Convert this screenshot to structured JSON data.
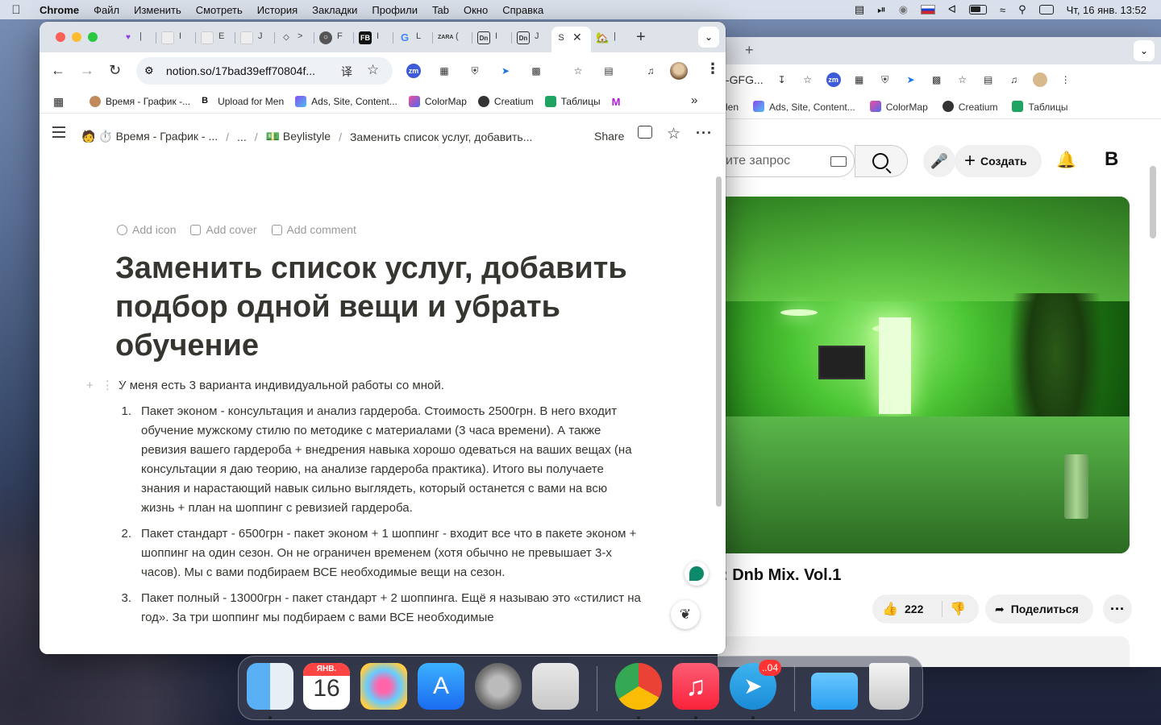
{
  "menubar": {
    "app": "Chrome",
    "items": [
      "Файл",
      "Изменить",
      "Смотреть",
      "История",
      "Закладки",
      "Профили",
      "Tab",
      "Окно",
      "Справка"
    ],
    "datetime": "Чт, 16 янв.  13:52"
  },
  "front_window": {
    "tabs": [
      {
        "icon": "pocket-icon",
        "mark": "|"
      },
      {
        "icon": "thumbnail-icon",
        "mark": "I"
      },
      {
        "icon": "thumbnail-icon",
        "mark": "E"
      },
      {
        "icon": "thumbnail-icon",
        "mark": "J"
      },
      {
        "icon": "diamond-icon",
        "mark": ">"
      },
      {
        "icon": "globe-icon",
        "mark": "F"
      },
      {
        "icon": "fb-icon",
        "mark": "I"
      },
      {
        "icon": "google-icon",
        "mark": "L"
      },
      {
        "icon": "zara-icon",
        "mark": "("
      },
      {
        "icon": "dnb-icon",
        "mark": "I"
      },
      {
        "icon": "dnb-icon",
        "mark": "J"
      },
      {
        "icon": "notion-icon",
        "mark": "",
        "active": true
      },
      {
        "icon": "house-icon",
        "mark": "|"
      }
    ],
    "url": "notion.so/17bad39eff70804f...",
    "bookmarks": [
      {
        "icon": "person-icon",
        "label": "Время - График -..."
      },
      {
        "icon": "b-icon",
        "label": "Upload for Men"
      },
      {
        "icon": "ads-icon",
        "label": "Ads, Site, Content..."
      },
      {
        "icon": "colormap-icon",
        "label": "ColorMap"
      },
      {
        "icon": "creatium-icon",
        "label": "Creatium"
      },
      {
        "icon": "sheets-icon",
        "label": "Таблицы"
      },
      {
        "icon": "m-icon",
        "label": ""
      }
    ],
    "notion": {
      "breadcrumbs": [
        "⏱️ Время - График - ...",
        "...",
        "💵 Beylistyle",
        "Заменить список услуг, добавить..."
      ],
      "share_label": "Share",
      "meta": {
        "add_icon": "Add icon",
        "add_cover": "Add cover",
        "add_comment": "Add comment"
      },
      "title": "Заменить список услуг, добавить подбор одной вещи и убрать обучение",
      "intro": "У меня есть 3 варианта индивидуальной работы со мной.",
      "items": [
        {
          "num": "1.",
          "text": "Пакет эконом - консультация и анализ гардероба. Стоимость 2500грн. В него входит обучение мужскому стилю по методике с материалами (3 часа времени). А также ревизия вашего гардероба + внедрения навыка хорошо одеваться на ваших вещах (на консультации я даю теорию, на анализе гардероба практика). Итого вы получаете знания и нарастающий навык сильно выглядеть, который останется с вами на всю жизнь + план на шоппинг с ревизией гардероба."
        },
        {
          "num": "2.",
          "text": "Пакет стандарт - 6500грн - пакет эконом + 1 шоппинг - входит все что в пакете эконом + шоппинг на один сезон. Он не ограничен временем (хотя обычно не превышает 3-х часов). Мы с вами подбираем ВСЕ необходимые вещи на сезон."
        },
        {
          "num": "3.",
          "text": "Пакет полный - 13000грн - пакет стандарт + 2 шоппинга. Ещё я называю это «стилист на год». За три шоппинг мы подбираем с вами ВСЕ необходимые"
        }
      ]
    }
  },
  "back_window": {
    "search_placeholder": "ите запрос",
    "url_fragment": "-GFG...",
    "create_label": "Создать",
    "bookmarks": [
      "len",
      "Ads, Site, Content...",
      "ColorMap",
      "Creatium",
      "Таблицы"
    ],
    "video_title": ": Dnb Mix. Vol.1",
    "likes": "222",
    "share_label": "Поделиться"
  },
  "dock": {
    "calendar_month": "ЯНВ.",
    "calendar_day": "16",
    "telegram_badge": "..04"
  }
}
